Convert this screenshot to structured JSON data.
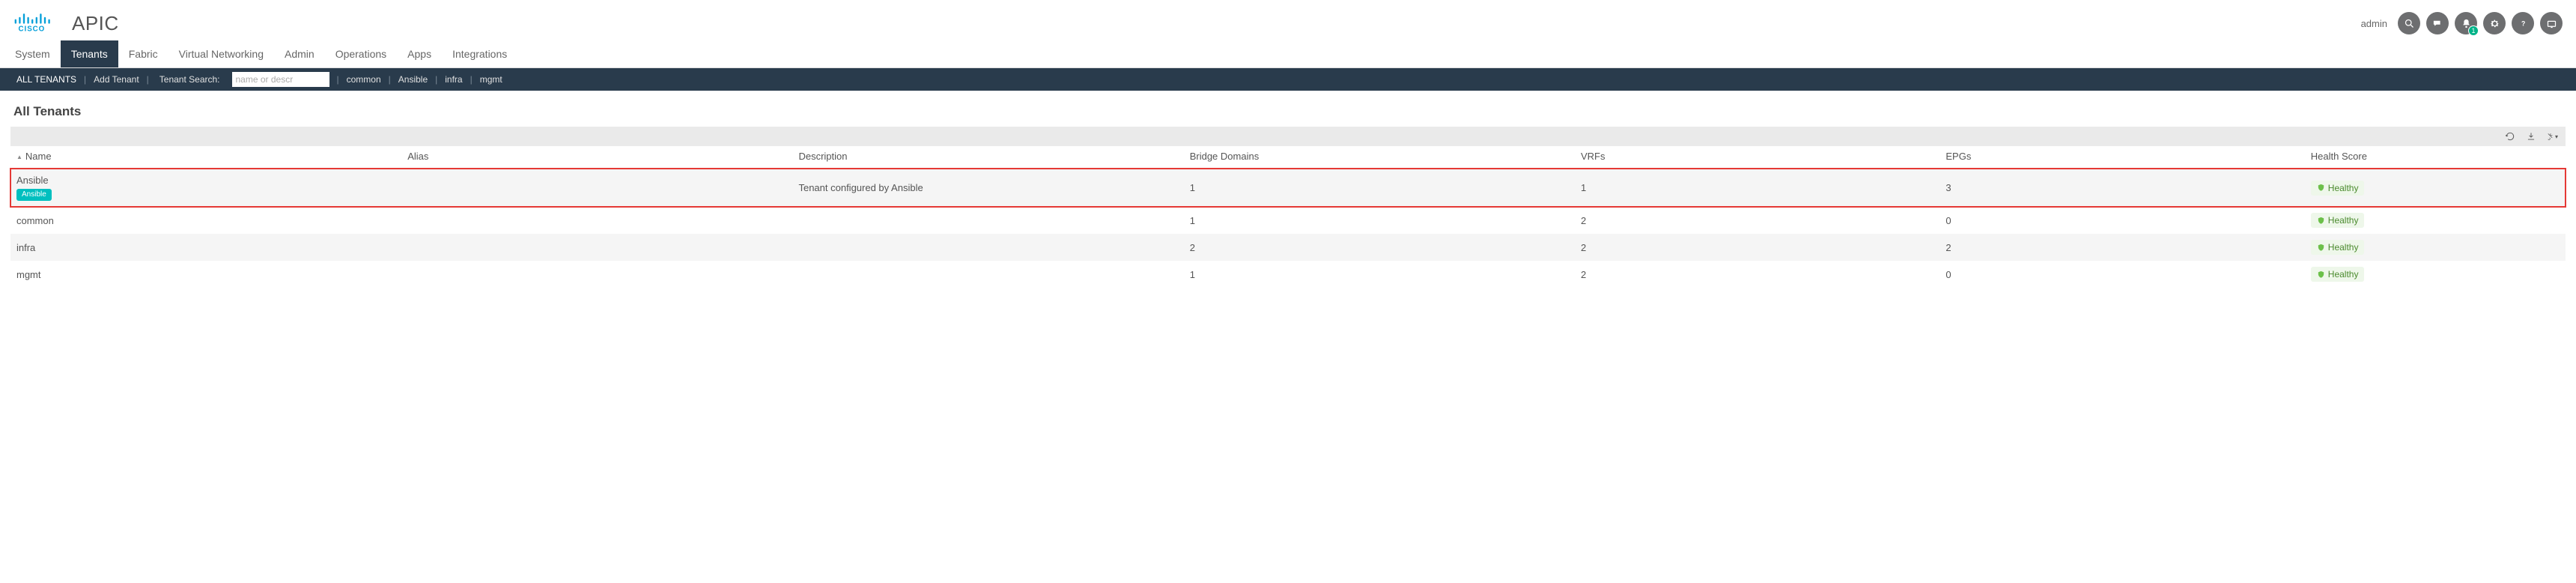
{
  "header": {
    "app_title": "APIC",
    "username": "admin",
    "notification_badge": "1"
  },
  "main_nav": [
    {
      "label": "System",
      "active": false
    },
    {
      "label": "Tenants",
      "active": true
    },
    {
      "label": "Fabric",
      "active": false
    },
    {
      "label": "Virtual Networking",
      "active": false
    },
    {
      "label": "Admin",
      "active": false
    },
    {
      "label": "Operations",
      "active": false
    },
    {
      "label": "Apps",
      "active": false
    },
    {
      "label": "Integrations",
      "active": false
    }
  ],
  "sub_nav": {
    "all_label": "ALL TENANTS",
    "add_label": "Add Tenant",
    "search_label": "Tenant Search:",
    "search_placeholder": "name or descr",
    "links": [
      "common",
      "Ansible",
      "infra",
      "mgmt"
    ]
  },
  "page": {
    "title": "All Tenants"
  },
  "table": {
    "columns": {
      "name": "Name",
      "alias": "Alias",
      "description": "Description",
      "bridge_domains": "Bridge Domains",
      "vrfs": "VRFs",
      "epgs": "EPGs",
      "health": "Health Score"
    },
    "rows": [
      {
        "name": "Ansible",
        "tag": "Ansible",
        "alias": "",
        "description": "Tenant configured by Ansible",
        "bridge_domains": "1",
        "vrfs": "1",
        "epgs": "3",
        "health": "Healthy",
        "highlighted": true,
        "stripe": true
      },
      {
        "name": "common",
        "tag": null,
        "alias": "",
        "description": "",
        "bridge_domains": "1",
        "vrfs": "2",
        "epgs": "0",
        "health": "Healthy",
        "highlighted": false,
        "stripe": false
      },
      {
        "name": "infra",
        "tag": null,
        "alias": "",
        "description": "",
        "bridge_domains": "2",
        "vrfs": "2",
        "epgs": "2",
        "health": "Healthy",
        "highlighted": false,
        "stripe": true
      },
      {
        "name": "mgmt",
        "tag": null,
        "alias": "",
        "description": "",
        "bridge_domains": "1",
        "vrfs": "2",
        "epgs": "0",
        "health": "Healthy",
        "highlighted": false,
        "stripe": false
      }
    ]
  }
}
